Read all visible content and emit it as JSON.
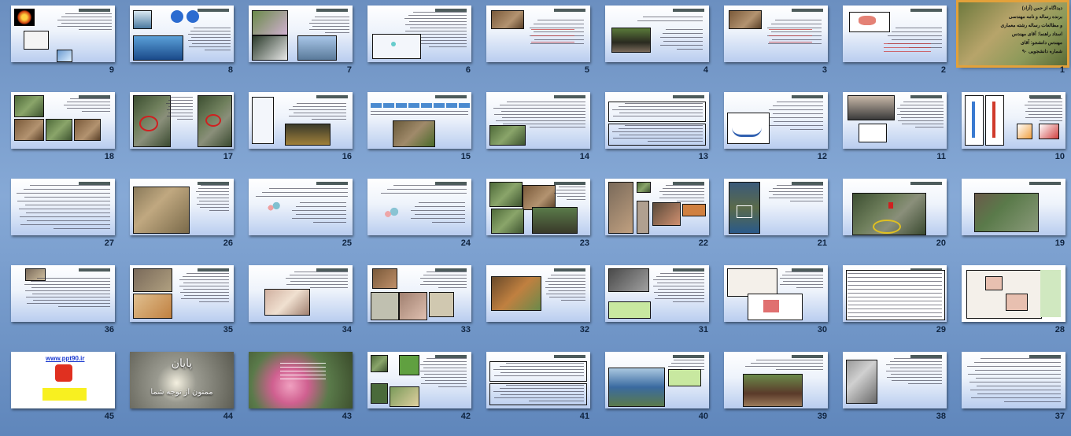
{
  "slides": [
    {
      "n": "1",
      "variant": "title",
      "title_lines": [
        "دیداگاه از حمن (آزاد)",
        "برنده رساله و نامه مهندسی",
        "و مطالعات رساله رشته معماری",
        "استاد راهنما: آقای مهندس",
        "مهندس دانشجو: آقای",
        "شماره دانشجویی ۹۰"
      ]
    },
    {
      "n": "2",
      "variant": "map"
    },
    {
      "n": "3",
      "variant": "list-photo"
    },
    {
      "n": "4",
      "variant": "photo-left"
    },
    {
      "n": "5",
      "variant": "list-photo"
    },
    {
      "n": "6",
      "variant": "text-map"
    },
    {
      "n": "7",
      "variant": "photos4"
    },
    {
      "n": "8",
      "variant": "water"
    },
    {
      "n": "9",
      "variant": "sun"
    },
    {
      "n": "10",
      "variant": "thermo"
    },
    {
      "n": "11",
      "variant": "wind"
    },
    {
      "n": "12",
      "variant": "curve"
    },
    {
      "n": "13",
      "variant": "boxed-text"
    },
    {
      "n": "14",
      "variant": "text-photo"
    },
    {
      "n": "15",
      "variant": "table-photo"
    },
    {
      "n": "16",
      "variant": "map-photo"
    },
    {
      "n": "17",
      "variant": "aerial2"
    },
    {
      "n": "18",
      "variant": "photos5"
    },
    {
      "n": "19",
      "variant": "photo-wide"
    },
    {
      "n": "20",
      "variant": "aerial"
    },
    {
      "n": "21",
      "variant": "aerial-tall"
    },
    {
      "n": "22",
      "variant": "collage"
    },
    {
      "n": "23",
      "variant": "photos3"
    },
    {
      "n": "24",
      "variant": "family"
    },
    {
      "n": "25",
      "variant": "family-text"
    },
    {
      "n": "26",
      "variant": "village"
    },
    {
      "n": "27",
      "variant": "list"
    },
    {
      "n": "28",
      "variant": "plan"
    },
    {
      "n": "29",
      "variant": "table"
    },
    {
      "n": "30",
      "variant": "plan-3d"
    },
    {
      "n": "31",
      "variant": "photo-text-green"
    },
    {
      "n": "32",
      "variant": "cows"
    },
    {
      "n": "33",
      "variant": "animals"
    },
    {
      "n": "34",
      "variant": "rabbits"
    },
    {
      "n": "35",
      "variant": "materials"
    },
    {
      "n": "36",
      "variant": "list-photo-small"
    },
    {
      "n": "37",
      "variant": "text"
    },
    {
      "n": "38",
      "variant": "stone"
    },
    {
      "n": "39",
      "variant": "house"
    },
    {
      "n": "40",
      "variant": "house-green"
    },
    {
      "n": "41",
      "variant": "boxed-text2"
    },
    {
      "n": "42",
      "variant": "eco"
    },
    {
      "n": "43",
      "variant": "flower"
    },
    {
      "n": "44",
      "variant": "end",
      "title": "پایان",
      "subtitle": "ممنون از توجه شما"
    },
    {
      "n": "45",
      "variant": "ppt90",
      "url": "www.ppt90.ir"
    }
  ],
  "colors": {
    "selection": "#e3a13a",
    "background": "#7a9fd0",
    "number": "#10243f"
  }
}
